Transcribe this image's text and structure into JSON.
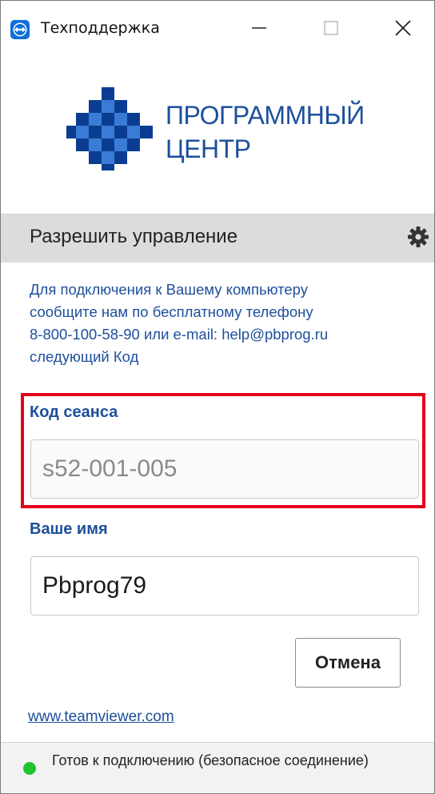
{
  "window": {
    "title": "Техподдержка",
    "icon": "teamviewer-icon",
    "controls": [
      "minimize-icon",
      "maximize-icon",
      "close-icon"
    ]
  },
  "logo": {
    "line1": "ПРОГРАММНЫЙ",
    "line2": "ЦЕНТР",
    "color": "#1d4f9c"
  },
  "section": {
    "title": "Разрешить управление",
    "settings_icon": "gear-icon"
  },
  "description": {
    "line1": "Для подключения к Вашему компьютеру",
    "line2": "сообщите нам по бесплатному телефону",
    "line3": "8-800-100-58-90 или e-mail: help@pbprog.ru",
    "line4": "следующий Код"
  },
  "session": {
    "label": "Код сеанса",
    "value": "s52-001-005"
  },
  "user": {
    "label": "Ваше имя",
    "value": "Pbprog79"
  },
  "buttons": {
    "cancel": "Отмена"
  },
  "link": {
    "text": "www.teamviewer.com"
  },
  "status": {
    "text": "Готов к подключению (безопасное соединение)",
    "color": "#22c22e"
  },
  "colors": {
    "accent": "#1d4f9c",
    "highlight": "#e3001b"
  }
}
